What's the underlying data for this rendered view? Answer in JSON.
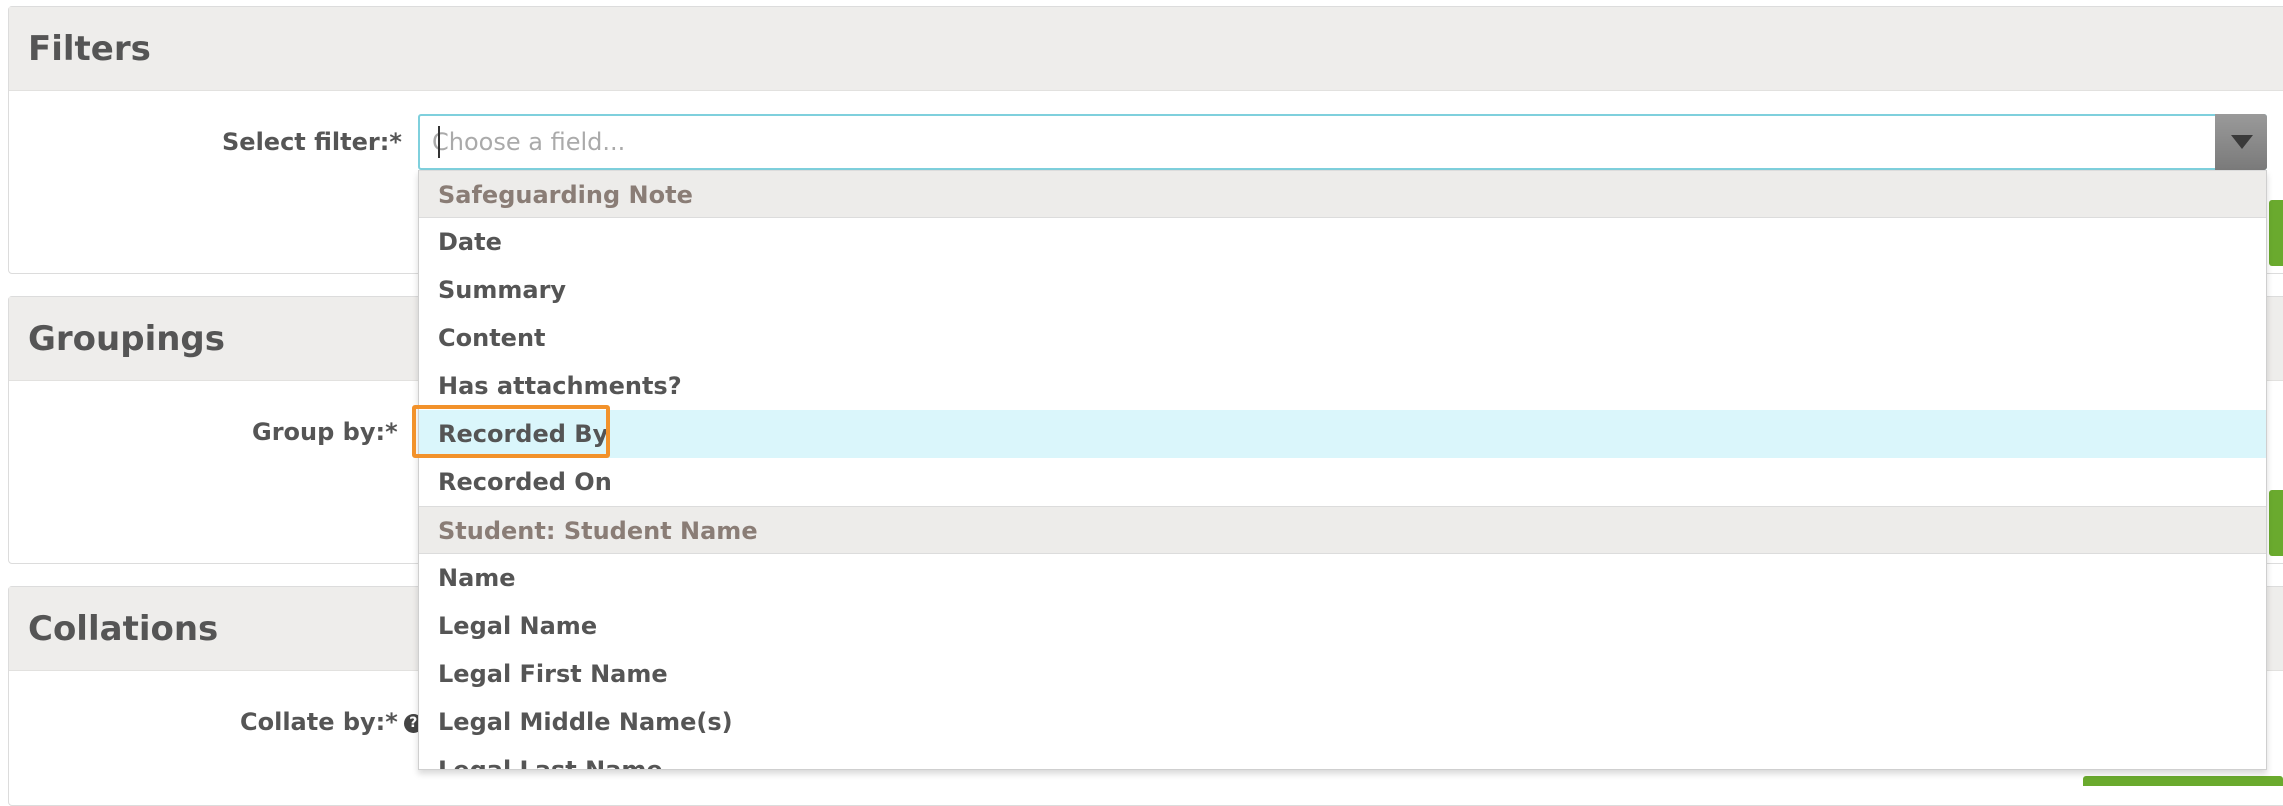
{
  "filters": {
    "title": "Filters",
    "select_label": "Select filter:*",
    "placeholder": "Choose a field..."
  },
  "groupings": {
    "title": "Groupings",
    "group_label": "Group by:*"
  },
  "collations": {
    "title": "Collations",
    "collate_label": "Collate by:*",
    "help_icon": "question-circle-icon"
  },
  "dropdown": {
    "groups": [
      {
        "label": "Safeguarding Note",
        "options": [
          "Date",
          "Summary",
          "Content",
          "Has attachments?",
          "Recorded By",
          "Recorded On"
        ]
      },
      {
        "label": "Student: Student Name",
        "options": [
          "Name",
          "Legal Name",
          "Legal First Name",
          "Legal Middle Name(s)",
          "Legal Last Name"
        ]
      }
    ],
    "highlighted_option": "Recorded By"
  },
  "colors": {
    "highlight_border": "#f2922b",
    "hover_bg": "#daf6fb",
    "focus_border": "#7fd0dd",
    "action_green": "#6aaa2e"
  }
}
